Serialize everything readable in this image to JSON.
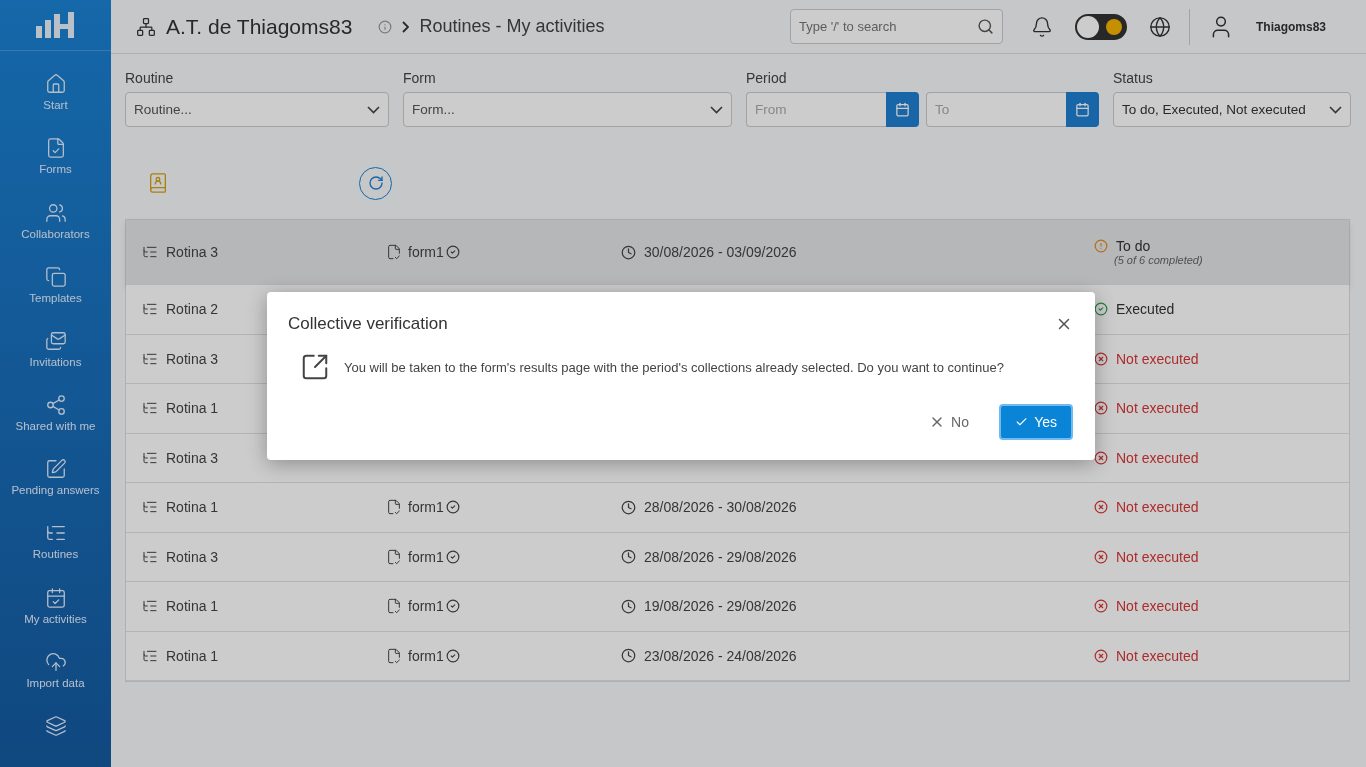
{
  "header": {
    "organization": "A.T. de Thiagoms83",
    "breadcrumb": "Routines - My activities",
    "search": {
      "placeholder": "Type '/' to search"
    },
    "dark_mode": false,
    "user": "Thiagoms83"
  },
  "sidebar": {
    "items": [
      {
        "label": "Start",
        "selected": false
      },
      {
        "label": "Forms",
        "selected": false
      },
      {
        "label": "Collaborators",
        "selected": false
      },
      {
        "label": "Templates",
        "selected": false
      },
      {
        "label": "Invitations",
        "selected": false
      },
      {
        "label": "Shared with me",
        "selected": false
      },
      {
        "label": "Pending answers",
        "selected": false
      },
      {
        "label": "Routines",
        "selected": false
      },
      {
        "label": "My activities",
        "selected": false
      },
      {
        "label": "Import data",
        "selected": false
      }
    ]
  },
  "filters": {
    "routine": {
      "label": "Routine",
      "placeholder": "Routine..."
    },
    "form": {
      "label": "Form",
      "placeholder": "Form..."
    },
    "period": {
      "label": "Period",
      "from_placeholder": "From",
      "to_placeholder": "To"
    },
    "status": {
      "label": "Status",
      "value": "To do, Executed, Not executed"
    }
  },
  "table": {
    "rows": [
      {
        "routine": "Rotina 3",
        "form": "form1",
        "period": "30/08/2026 - 03/09/2026",
        "status": "To do",
        "kind": "todo",
        "progress": "(5 of 6 completed)",
        "selected": true
      },
      {
        "routine": "Rotina 2",
        "status": "Executed",
        "kind": "executed",
        "selected": false
      },
      {
        "routine": "Rotina 3",
        "status": "Not executed",
        "kind": "not_executed",
        "selected": false
      },
      {
        "routine": "Rotina 1",
        "status": "Not executed",
        "kind": "not_executed",
        "selected": false
      },
      {
        "routine": "Rotina 3",
        "status": "Not executed",
        "kind": "not_executed",
        "selected": false
      },
      {
        "routine": "Rotina 1",
        "form": "form1",
        "period": "28/08/2026 - 30/08/2026",
        "status": "Not executed",
        "kind": "not_executed",
        "selected": false
      },
      {
        "routine": "Rotina 3",
        "form": "form1",
        "period": "28/08/2026 - 29/08/2026",
        "status": "Not executed",
        "kind": "not_executed",
        "selected": false
      },
      {
        "routine": "Rotina 1",
        "form": "form1",
        "period": "19/08/2026 - 29/08/2026",
        "status": "Not executed",
        "kind": "not_executed",
        "selected": false
      },
      {
        "routine": "Rotina 1",
        "form": "form1",
        "period": "23/08/2026 - 24/08/2026",
        "status": "Not executed",
        "kind": "not_executed",
        "selected": false
      }
    ]
  },
  "dialog": {
    "title": "Collective verification",
    "message": "You will be taken to the form's results page with the period's collections already selected. Do you want to continue?",
    "buttons": [
      {
        "label": "No",
        "kind": "cancel"
      },
      {
        "label": "Yes",
        "kind": "confirm"
      }
    ]
  }
}
